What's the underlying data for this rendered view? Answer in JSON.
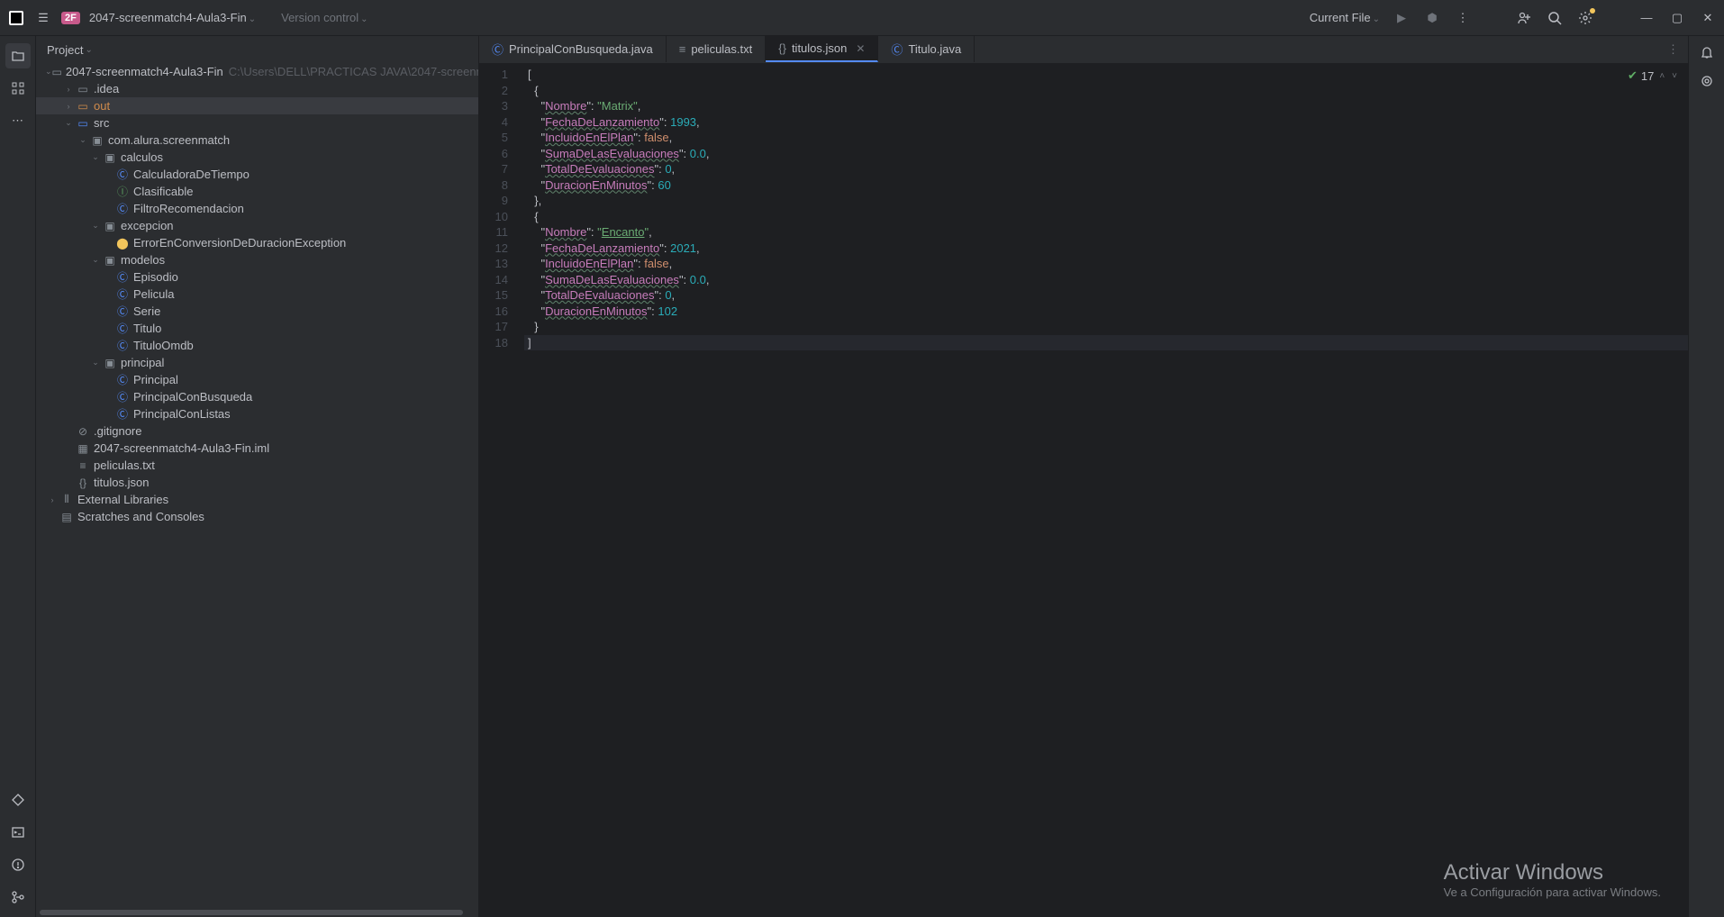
{
  "titlebar": {
    "badge": "2F",
    "project": "2047-screenmatch4-Aula3-Fin",
    "vc": "Version control",
    "current_file": "Current File"
  },
  "sidebar": {
    "label": "Project",
    "root": "2047-screenmatch4-Aula3-Fin",
    "root_path": "C:\\Users\\DELL\\PRACTICAS JAVA\\2047-screenmatch4-Aula3-...",
    "idea": ".idea",
    "out": "out",
    "src": "src",
    "pkg": "com.alura.screenmatch",
    "calculos": "calculos",
    "calc1": "CalculadoraDeTiempo",
    "calc2": "Clasificable",
    "calc3": "FiltroRecomendacion",
    "excepcion": "excepcion",
    "exc1": "ErrorEnConversionDeDuracionException",
    "modelos": "modelos",
    "mod1": "Episodio",
    "mod2": "Pelicula",
    "mod3": "Serie",
    "mod4": "Titulo",
    "mod5": "TituloOmdb",
    "principal": "principal",
    "prin1": "Principal",
    "prin2": "PrincipalConBusqueda",
    "prin3": "PrincipalConListas",
    "gitignore": ".gitignore",
    "iml": "2047-screenmatch4-Aula3-Fin.iml",
    "peliculas": "peliculas.txt",
    "titulos": "titulos.json",
    "extlib": "External Libraries",
    "scratches": "Scratches and Consoles"
  },
  "tabs": {
    "t1": "PrincipalConBusqueda.java",
    "t2": "peliculas.txt",
    "t3": "titulos.json",
    "t4": "Titulo.java"
  },
  "inspection": {
    "count": "17"
  },
  "code": {
    "k_nombre": "Nombre",
    "v_matrix": "Matrix",
    "k_fecha": "FechaDeLanzamiento",
    "v_1993": "1993",
    "k_incl": "IncluidoEnElPlan",
    "v_false": "false",
    "k_suma": "SumaDeLasEvaluaciones",
    "v_00": "0.0",
    "k_total": "TotalDeEvaluaciones",
    "v_0": "0",
    "k_dur": "DuracionEnMinutos",
    "v_60": "60",
    "v_encanto": "Encanto",
    "v_2021": "2021",
    "v_102": "102"
  },
  "watermark": {
    "big": "Activar Windows",
    "small": "Ve a Configuración para activar Windows."
  }
}
